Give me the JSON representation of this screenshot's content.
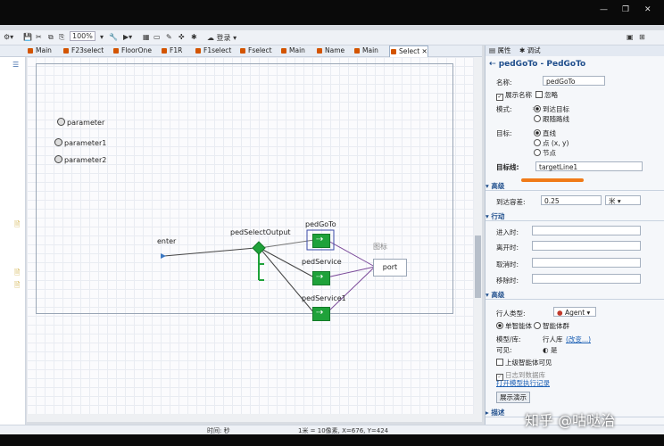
{
  "window": {
    "minimize": "—",
    "maximize": "❐",
    "close": "✕"
  },
  "toolbar": {
    "zoom": "100%",
    "login": "登录"
  },
  "tabs": [
    {
      "label": "Main"
    },
    {
      "label": "F23select"
    },
    {
      "label": "FloorOne"
    },
    {
      "label": "F1R"
    },
    {
      "label": "F1select"
    },
    {
      "label": "Fselect"
    },
    {
      "label": "Main"
    },
    {
      "label": "Name"
    },
    {
      "label": "Main"
    },
    {
      "label": "Select"
    }
  ],
  "canvas": {
    "params": [
      "parameter",
      "parameter1",
      "parameter2"
    ],
    "labels": {
      "enter": "enter",
      "pedSelectOutput": "pedSelectOutput",
      "pedGoTo": "pedGoTo",
      "pedService": "pedService",
      "pedService1": "pedService1",
      "port": "port",
      "icon": "图标"
    }
  },
  "status": {
    "scale": "1米 = 10像素, X=676, Y=424",
    "time": "时间: 秒"
  },
  "props": {
    "tab_props": "属性",
    "tab_debug": "调试",
    "title": "pedGoTo - PedGoTo",
    "name_label": "名称:",
    "name_value": "pedGoTo",
    "show_name": "展示名称",
    "ignore": "忽略",
    "mode_label": "模式:",
    "mode_opt1": "到达目标",
    "mode_opt2": "跟随路线",
    "target_label": "目标:",
    "target_opt1": "直线",
    "target_opt2": "点 (x, y)",
    "target_opt3": "节点",
    "target_line_label": "目标线:",
    "target_line_value": "targetLine1",
    "sect_advanced": "高级",
    "tolerance_label": "到达容差:",
    "tolerance_value": "0.25",
    "tolerance_unit": "米",
    "sect_actions": "行动",
    "on_enter": "进入时:",
    "on_exit": "离开时:",
    "on_cancel": "取消时:",
    "on_remove": "移除时:",
    "sect_advanced2": "高级",
    "agent_type_label": "行人类型:",
    "agent_type_value": "Agent",
    "single": "单智能体",
    "population": "智能体群",
    "model_label": "模型/库:",
    "model_value": "行人库",
    "model_change": "(改变...)",
    "visible_label": "可见:",
    "visible_value": "是",
    "upper_visible": "上级智能体可见",
    "log_db": "日志到数据库",
    "open_log": "打开模型执行记录",
    "demo_button": "展示演示",
    "sect_desc": "描述"
  },
  "watermark": "知乎 @咕哒治",
  "colors": {
    "block": "#1fa23a",
    "accent": "#1f4e8c",
    "highlight": "#f07a18"
  }
}
